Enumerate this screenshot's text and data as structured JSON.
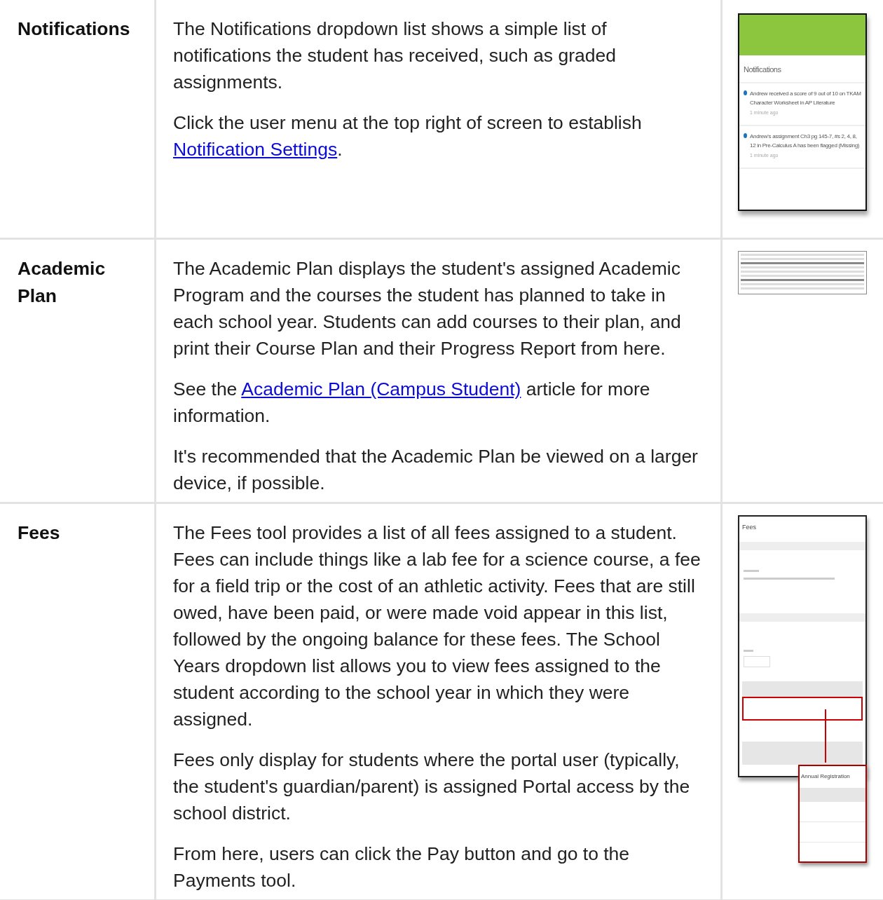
{
  "rows": [
    {
      "heading": "Notifications",
      "paragraphs": [
        [
          {
            "text": "The Notifications dropdown list shows a simple list of notifications the student has received, such as graded assignments."
          }
        ],
        [
          {
            "text": "Click the user menu at the top right of screen to establish "
          },
          {
            "link": "Notification Settings"
          },
          {
            "text": "."
          }
        ]
      ],
      "thumbnail": {
        "kind": "notifications",
        "title": "Notifications",
        "items": [
          {
            "text": "Andrew received a score of 9 out of 10 on TKAM Character Worksheet in AP Literature",
            "time": "1 minute ago"
          },
          {
            "text": "Andrew's assignment Ch3 pg 145-7, #s 2, 4, 8, 12 in Pre-Calculus A has been flagged (Missing)",
            "time": "1 minute ago"
          }
        ]
      }
    },
    {
      "heading": "Academic Plan",
      "paragraphs": [
        [
          {
            "text": "The Academic Plan displays the student's assigned Academic Program and the courses the student has planned to take in each school year. Students can add courses to their plan, and print their Course Plan and their Progress Report from here."
          }
        ],
        [
          {
            "text": "See the "
          },
          {
            "link": "Academic Plan (Campus Student)"
          },
          {
            "text": " article for more information."
          }
        ],
        [
          {
            "text": "It's recommended that the Academic Plan be viewed on a larger device, if possible."
          }
        ]
      ],
      "thumbnail": {
        "kind": "academic-plan"
      }
    },
    {
      "heading": "Fees",
      "paragraphs": [
        [
          {
            "text": "The Fees tool provides a list of all fees assigned to a student. Fees can include things like a lab fee for a science course, a fee for a field trip or the cost of an athletic activity. Fees that are still owed, have been paid, or were made void appear in this list, followed by the ongoing balance for these fees. The School Years dropdown list allows you to view fees assigned to the student according to the school year in which they were assigned."
          }
        ],
        [
          {
            "text": "Fees only display for students where the portal user (typically, the student's guardian/parent) is assigned Portal access by the school district."
          }
        ],
        [
          {
            "text": "From here, users can click the Pay button and go to the Payments tool."
          }
        ]
      ],
      "thumbnail": {
        "kind": "fees",
        "title": "Fees",
        "popup_title": "Annual Registration"
      }
    }
  ]
}
